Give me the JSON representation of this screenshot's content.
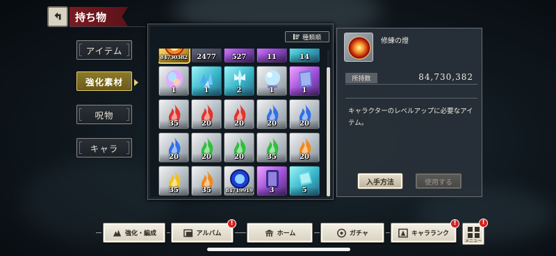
{
  "header": {
    "title": "持ち物",
    "back_icon": "back-arrow-icon"
  },
  "categories": [
    {
      "label": "アイテム",
      "active": false
    },
    {
      "label": "強化素材",
      "active": true
    },
    {
      "label": "呪物",
      "active": false
    },
    {
      "label": "キャラ",
      "active": false
    }
  ],
  "sort_button": {
    "label": "種類順",
    "icon": "sort-icon"
  },
  "grid_items": [
    {
      "count": "84730382",
      "frame": "gold",
      "icon": "flame-orb-icon"
    },
    {
      "count": "2477",
      "frame": "dark",
      "icon": "purple-crystal-icon"
    },
    {
      "count": "527",
      "frame": "purple",
      "icon": "purple-crystal-icon"
    },
    {
      "count": "11",
      "frame": "purple",
      "icon": "purple-crystal-icon"
    },
    {
      "count": "14",
      "frame": "cyan",
      "icon": "cyan-stone-icon"
    },
    {
      "count": "1",
      "frame": "silver",
      "icon": "rainbow-gem-icon"
    },
    {
      "count": "1",
      "frame": "cyan",
      "icon": "blue-shards-icon"
    },
    {
      "count": "2",
      "frame": "cyan",
      "icon": "crystal-tree-icon"
    },
    {
      "count": "1",
      "frame": "silver",
      "icon": "crystal-ball-icon"
    },
    {
      "count": "1",
      "frame": "purple",
      "icon": "tablet-icon"
    },
    {
      "count": "35",
      "frame": "silver",
      "icon": "red-flame-icon",
      "color": "#e0352b"
    },
    {
      "count": "20",
      "frame": "silver",
      "icon": "red-flame-icon",
      "color": "#e0352b"
    },
    {
      "count": "20",
      "frame": "silver",
      "icon": "red-flame-icon",
      "color": "#e0352b"
    },
    {
      "count": "20",
      "frame": "silver",
      "icon": "blue-flame-icon",
      "color": "#2f6fe8"
    },
    {
      "count": "20",
      "frame": "silver",
      "icon": "blue-flame-icon",
      "color": "#2f6fe8"
    },
    {
      "count": "20",
      "frame": "silver",
      "icon": "blue-flame-icon",
      "color": "#2f6fe8"
    },
    {
      "count": "20",
      "frame": "silver",
      "icon": "green-flame-icon",
      "color": "#2fbf3c"
    },
    {
      "count": "20",
      "frame": "silver",
      "icon": "green-flame-icon",
      "color": "#2fbf3c"
    },
    {
      "count": "35",
      "frame": "silver",
      "icon": "green-flame-icon",
      "color": "#2fbf3c"
    },
    {
      "count": "20",
      "frame": "silver",
      "icon": "orange-flame-icon",
      "color": "#f08a1c"
    },
    {
      "count": "35",
      "frame": "silver",
      "icon": "yellow-flame-icon",
      "color": "#f2c21a"
    },
    {
      "count": "35",
      "frame": "silver",
      "icon": "orange-flame-icon",
      "color": "#f08a1c"
    },
    {
      "count": "84719919",
      "frame": "silver",
      "icon": "blue-orb-icon"
    },
    {
      "count": "3",
      "frame": "purple",
      "icon": "purple-mirror-icon"
    },
    {
      "count": "5",
      "frame": "cyan",
      "icon": "cyan-book-icon"
    }
  ],
  "detail": {
    "name": "修練の燈",
    "icon": "flame-orb-icon",
    "owned_label": "所持数",
    "owned_value": "84,730,382",
    "description": "キャラクターのレベルアップに必要なアイテム。",
    "acquire_label": "入手方法",
    "use_label": "使用する"
  },
  "bottom_nav": [
    {
      "label": "強化・編成",
      "icon": "enhance-icon",
      "badge": ""
    },
    {
      "label": "アルバム",
      "icon": "album-icon",
      "badge": "!"
    },
    {
      "label": "ホーム",
      "icon": "home-icon",
      "badge": ""
    },
    {
      "label": "ガチャ",
      "icon": "gacha-icon",
      "badge": ""
    },
    {
      "label": "キャラランク",
      "icon": "rank-icon",
      "badge": "!"
    }
  ],
  "menu_button": {
    "label": "メニュー",
    "badge": "!"
  },
  "colors": {
    "accent_gold": "#8d7a28",
    "banner_red": "#7a1b22",
    "badge_red": "#d32222"
  }
}
